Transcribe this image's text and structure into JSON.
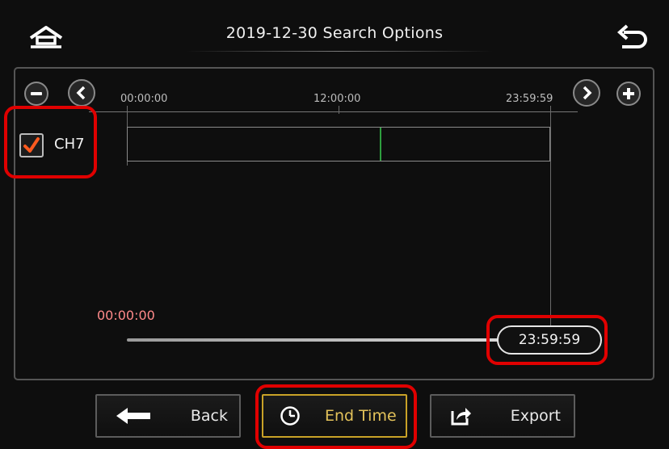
{
  "header": {
    "title": "2019-12-30 Search Options",
    "home_icon": "home-icon",
    "back_icon": "undo-arrow-icon"
  },
  "timeline": {
    "zoom_out_label": "−",
    "zoom_in_label": "+",
    "ticks": [
      "00:00:00",
      "12:00:00",
      "23:59:59"
    ]
  },
  "channel": {
    "label": "CH7",
    "checked": true
  },
  "range": {
    "start_time": "00:00:00",
    "end_time": "23:59:59"
  },
  "buttons": {
    "back_label": "Back",
    "end_time_label": "End Time",
    "export_label": "Export"
  },
  "colors": {
    "highlight": "#e00000",
    "accent_gold": "#c9a227",
    "end_time_text": "#e3c25a",
    "start_time_text": "#ff8a8a",
    "recording_marker": "#2e9e3e",
    "check_mark": "#ff5a1f"
  }
}
